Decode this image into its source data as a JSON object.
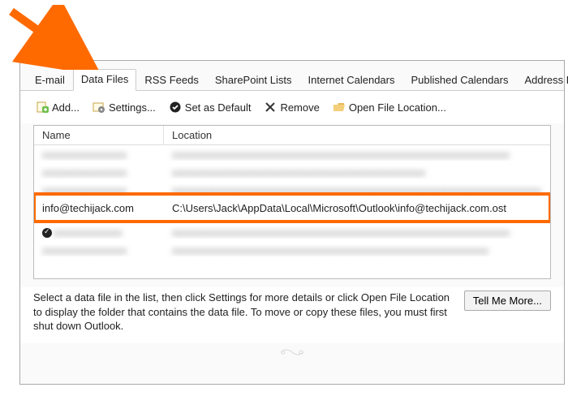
{
  "annotation": {
    "arrow_color": "#ff6a00"
  },
  "tabs": [
    {
      "label": "E-mail"
    },
    {
      "label": "Data Files"
    },
    {
      "label": "RSS Feeds"
    },
    {
      "label": "SharePoint Lists"
    },
    {
      "label": "Internet Calendars"
    },
    {
      "label": "Published Calendars"
    },
    {
      "label": "Address Books"
    }
  ],
  "active_tab_index": 1,
  "toolbar": {
    "add": "Add...",
    "settings": "Settings...",
    "default": "Set as Default",
    "remove": "Remove",
    "open": "Open File Location..."
  },
  "columns": {
    "name": "Name",
    "location": "Location"
  },
  "rows": [
    {
      "name": "",
      "location": "",
      "redacted": true
    },
    {
      "name": "",
      "location": "",
      "redacted": true
    },
    {
      "name": "",
      "location": "",
      "redacted": true
    },
    {
      "name": "info@techijack.com",
      "location": "C:\\Users\\Jack\\AppData\\Local\\Microsoft\\Outlook\\info@techijack.com.ost",
      "redacted": false
    },
    {
      "name": "",
      "location": "",
      "redacted": true,
      "default": true
    },
    {
      "name": "",
      "location": "",
      "redacted": true
    }
  ],
  "highlight_row_index": 3,
  "hint": "Select a data file in the list, then click Settings for more details or click Open File Location to display the folder that contains the data file. To move or copy these files, you must first shut down Outlook.",
  "more_button": "Tell Me More..."
}
